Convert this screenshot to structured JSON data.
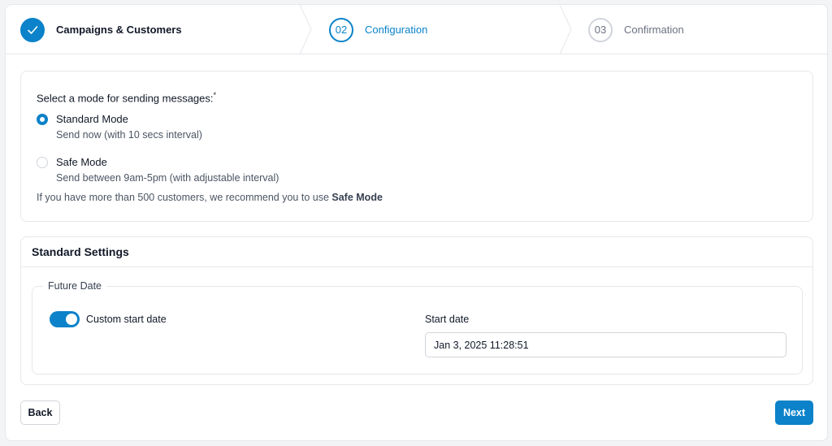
{
  "stepper": {
    "steps": [
      {
        "number": "",
        "label": "Campaigns & Customers",
        "state": "done"
      },
      {
        "number": "02",
        "label": "Configuration",
        "state": "active"
      },
      {
        "number": "03",
        "label": "Confirmation",
        "state": "pending"
      }
    ]
  },
  "mode": {
    "title": "Select a mode for sending messages:",
    "required_mark": "*",
    "options": [
      {
        "label": "Standard Mode",
        "description": "Send now (with 10 secs interval)",
        "selected": true
      },
      {
        "label": "Safe Mode",
        "description": "Send between 9am-5pm (with adjustable interval)",
        "selected": false
      }
    ],
    "hint_prefix": "If you have more than 500 customers, we recommend you to use",
    "hint_bold": "Safe Mode"
  },
  "settings": {
    "title": "Standard Settings",
    "group_legend": "Future Date",
    "toggle_label": "Custom start date",
    "toggle_on": true,
    "start_date_label": "Start date",
    "start_date_value": "Jan 3, 2025 11:28:51"
  },
  "footer": {
    "back_label": "Back",
    "next_label": "Next"
  },
  "colors": {
    "accent": "#0b82c9",
    "border": "#e5e7eb"
  }
}
